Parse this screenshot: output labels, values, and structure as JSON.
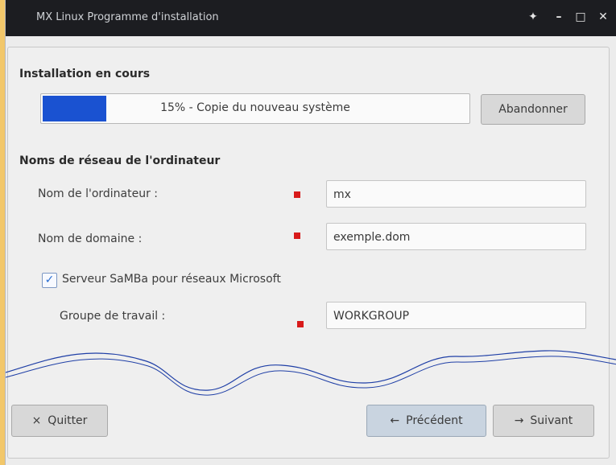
{
  "window": {
    "title": "MX Linux Programme d'installation",
    "controls": [
      "pin-icon",
      "minimize-icon",
      "maximize-icon",
      "close-icon"
    ]
  },
  "progress": {
    "section_title": "Installation en cours",
    "text": "15% - Copie du nouveau système",
    "value_percent": 15,
    "abort_label": "Abandonner"
  },
  "network": {
    "section_title": "Noms de réseau de l'ordinateur",
    "computer_name_label": "Nom de l'ordinateur :",
    "computer_name_value": "mx",
    "domain_label": "Nom de domaine :",
    "domain_value": "exemple.dom",
    "samba_label": "Serveur SaMBa pour réseaux Microsoft",
    "samba_checked": true,
    "workgroup_label": "Groupe de travail :",
    "workgroup_value": "WORKGROUP"
  },
  "footer": {
    "quit_label": "Quitter",
    "prev_label": "Précédent",
    "next_label": "Suivant"
  },
  "colors": {
    "progress_fill": "#1a52d1",
    "required_marker": "#d81a1a",
    "titlebar": "#1c1d21"
  }
}
